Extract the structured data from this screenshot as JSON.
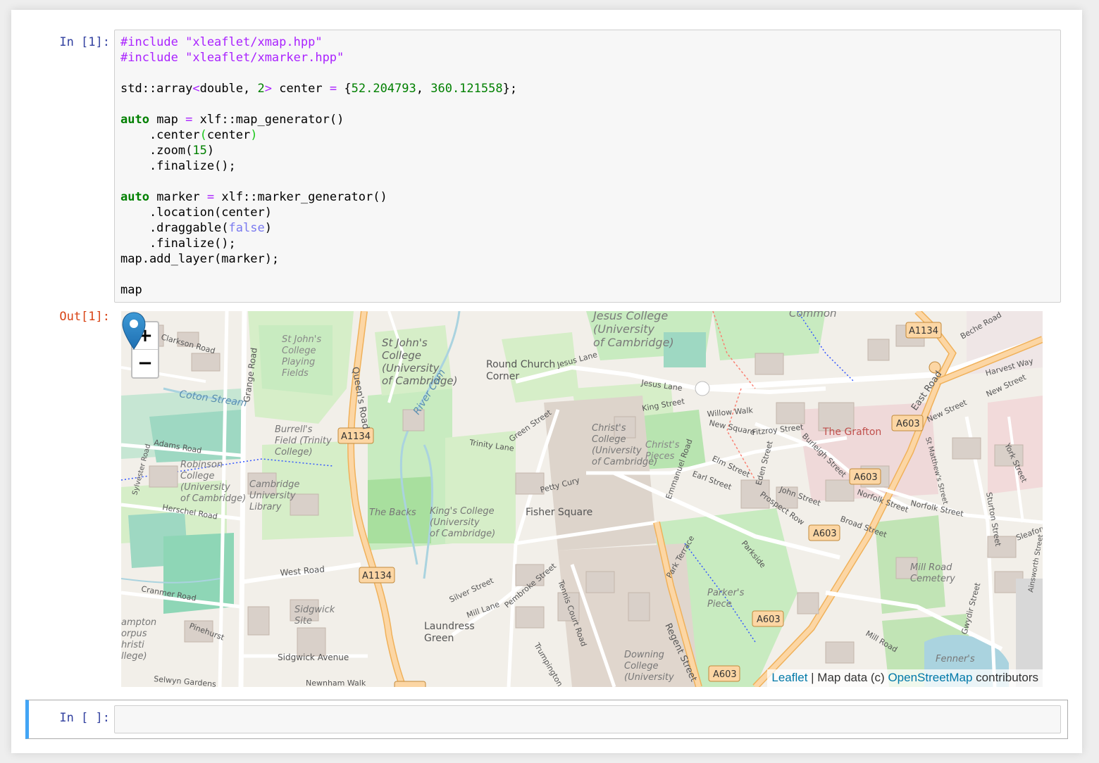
{
  "cells": {
    "input1": {
      "prompt": "In [1]:",
      "lines": [
        "#include \"xleaflet/xmap.hpp\"",
        "#include \"xleaflet/xmarker.hpp\"",
        "",
        "std::array<double, 2> center = {52.204793, 360.121558};",
        "",
        "auto map = xlf::map_generator()",
        "    .center(center)",
        "    .zoom(15)",
        "    .finalize();",
        "",
        "auto marker = xlf::marker_generator()",
        "    .location(center)",
        "    .draggable(false)",
        "    .finalize();",
        "map.add_layer(marker);",
        "",
        "map"
      ]
    },
    "output1": {
      "prompt": "Out[1]:"
    },
    "input2": {
      "prompt": "In [ ]:"
    }
  },
  "map": {
    "zoom_in": "+",
    "zoom_out": "−",
    "attribution": {
      "leaflet": "Leaflet",
      "separator": " | Map data (c) ",
      "osm": "OpenStreetMap",
      "suffix": " contributors"
    },
    "labels": {
      "jesus_college": [
        "Jesus College",
        "(University",
        "of Cambridge)"
      ],
      "common": "Common",
      "st_johns_playing": [
        "St John's",
        "College",
        "Playing",
        "Fields"
      ],
      "st_johns": [
        "St John's",
        "College",
        "(University",
        "of Cambridge)"
      ],
      "round_church": [
        "Round Church",
        "Corner"
      ],
      "coton_stream": "Coton Stream",
      "grange_road": "Grange Road",
      "queens_road": "Queen's Road",
      "river_cam": "River Cam",
      "jesus_lane": "Jesus Lane",
      "king_street": "King Street",
      "willow_walk": "Willow Walk",
      "new_square": "New Square",
      "fitzroy_street": "Fitzroy Street",
      "burleigh_street": "Burleigh Street",
      "the_grafton": "The Grafton",
      "east_road": "East Road",
      "new_street": "New Street",
      "harvest_way": "Harvest Way",
      "beche_road": "Beche Road",
      "a1134": "A1134",
      "a603": "A603",
      "burrells_field": [
        "Burrell's",
        "Field (Trinity",
        "College)"
      ],
      "adams_road": "Adams Road",
      "robinson_college": [
        "Robinson",
        "College",
        "(University",
        "of Cambridge)"
      ],
      "cambridge_library": [
        "Cambridge",
        "University",
        "Library"
      ],
      "trinity_lane": "Trinity Lane",
      "green_street": "Green Street",
      "christs_college": [
        "Christ's",
        "College",
        "(University",
        "of Cambridge)"
      ],
      "christs_pieces": [
        "Christ's",
        "Pieces"
      ],
      "emmanuel_road": "Emmanuel Road",
      "elm_street": "Elm Street",
      "earl_street": "Earl Street",
      "eden_street": "Eden Street",
      "john_street": "John Street",
      "prospect_row": "Prospect Row",
      "norfolk_street": "Norfolk Street",
      "broad_street": "Broad Street",
      "st_matthews_street": "St Matthew's Street",
      "york_street": "York Street",
      "sturton_street": "Sturton Street",
      "petty_cury": "Petty Cury",
      "fisher_square": "Fisher Square",
      "the_backs": "The Backs",
      "kings_college": [
        "King's College",
        "(University",
        "of Cambridge)"
      ],
      "herschel_road": "Herschel Road",
      "sylvester_road": "Sylvester Road",
      "clarkson_road": "Clarkson Road",
      "west_road": "West Road",
      "cranmer_road": "Cranmer Road",
      "sidgwick_site": [
        "Sidgwick",
        "Site"
      ],
      "silver_street": "Silver Street",
      "mill_lane": "Mill Lane",
      "pembroke_street": "Pembroke Street",
      "tennis_court_road": "Tennis Court Road",
      "laundress_green": [
        "Laundress",
        "Green"
      ],
      "parkside": "Parkside",
      "park_terrace": "Park Terrace",
      "parkers_piece": [
        "Parker's",
        "Piece"
      ],
      "mill_road_cemetery": [
        "Mill Road",
        "Cemetery"
      ],
      "mill_road": "Mill Road",
      "regent_street": "Regent Street",
      "trumpington_street": "Trumpington Street",
      "downing_college": [
        "Downing",
        "College",
        "(University"
      ],
      "sidgwick_avenue": "Sidgwick Avenue",
      "newnham_walk": "Newnham Walk",
      "selwyn_gardens": "Selwyn Gardens",
      "pinehurst": "Pinehurst",
      "fenners": "Fenner's",
      "gwydir_street": "Gwydir Street",
      "ainsworth_street": "Ainsworth Street",
      "sleaford": "Sleaford",
      "hampton": [
        "ampton",
        "orpus",
        "hristi",
        "llege)"
      ]
    }
  }
}
